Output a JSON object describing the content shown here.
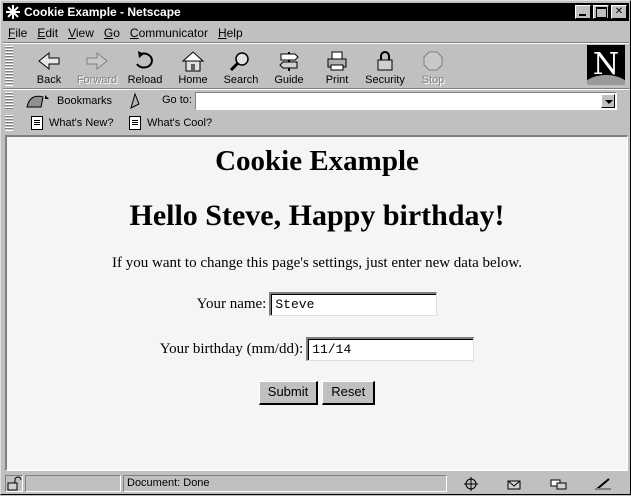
{
  "window": {
    "title": "Cookie Example - Netscape"
  },
  "menu": [
    {
      "key": "F",
      "rest": "ile"
    },
    {
      "key": "E",
      "rest": "dit"
    },
    {
      "key": "V",
      "rest": "iew"
    },
    {
      "key": "G",
      "rest": "o"
    },
    {
      "key": "C",
      "rest": "ommunicator"
    },
    {
      "key": "H",
      "rest": "elp"
    }
  ],
  "nav": {
    "back": "Back",
    "forward": "Forward",
    "reload": "Reload",
    "home": "Home",
    "search": "Search",
    "guide": "Guide",
    "print": "Print",
    "security": "Security",
    "stop": "Stop",
    "logo_letter": "N"
  },
  "location": {
    "bookmarks": "Bookmarks",
    "goto_label": "Go to:",
    "url": ""
  },
  "personal": {
    "whats_new": "What's New?",
    "whats_cool": "What's Cool?"
  },
  "page": {
    "heading": "Cookie Example",
    "greeting": "Hello Steve, Happy birthday!",
    "instructions": "If you want to change this page's settings, just enter new data below.",
    "name_label": "Your name:",
    "name_value": "Steve",
    "birthday_label": "Your birthday (mm/dd):",
    "birthday_value": "11/14",
    "submit": "Submit",
    "reset": "Reset"
  },
  "status": {
    "text": "Document: Done"
  },
  "colors": {
    "chrome": "#c0c0c0",
    "titlebar": "#000000",
    "content_bg": "#f5f5f5"
  }
}
